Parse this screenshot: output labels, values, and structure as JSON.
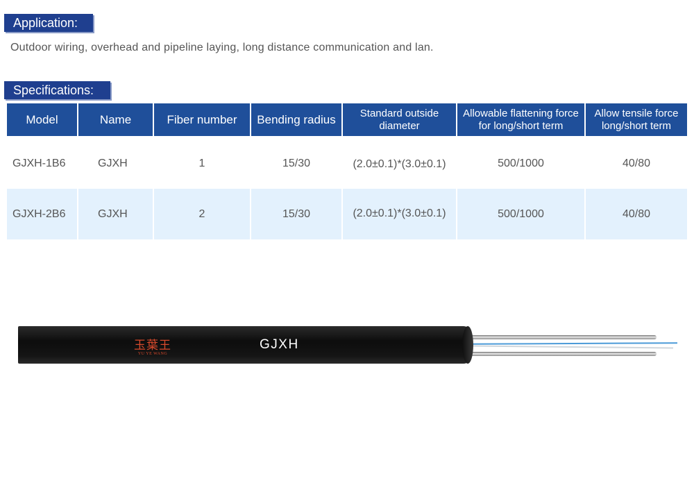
{
  "application": {
    "heading": "Application:",
    "text": "Outdoor wiring, overhead and pipeline laying, long distance communication and lan."
  },
  "specifications": {
    "heading": "Specifications:",
    "columns": [
      {
        "label_line1": "Model",
        "label_line2": ""
      },
      {
        "label_line1": "Name",
        "label_line2": ""
      },
      {
        "label_line1": "Fiber number",
        "label_line2": ""
      },
      {
        "label_line1": "Bending radius",
        "label_line2": ""
      },
      {
        "label_line1": "Standard outside",
        "label_line2": "diameter"
      },
      {
        "label_line1": "Allowable flattening force",
        "label_line2": "for long/short term"
      },
      {
        "label_line1": "Allow tensile force",
        "label_line2": "long/short term"
      }
    ],
    "rows": [
      [
        "GJXH-1B6",
        "GJXH",
        "1",
        "15/30",
        "(2.0±0.1)*(3.0±0.1)",
        "500/1000",
        "40/80"
      ],
      [
        "GJXH-2B6",
        "GJXH",
        "2",
        "15/30",
        "(2.0±0.1)*(3.0±0.1)",
        "500/1000",
        "40/80"
      ]
    ]
  },
  "cable_image": {
    "brand_name": "玉葉王",
    "brand_sub": "YU YE WANG",
    "label": "GJXH",
    "colors": {
      "jacket": "#111111",
      "brand": "#d84a2c",
      "fiber_blue": "#4a9ad8",
      "steel_wire": "#c8c8c8"
    }
  },
  "colors": {
    "header_bg": "#1f4f9a",
    "tag_bg": "#1f3f8f",
    "stripe_bg": "#e3f1fd",
    "text": "#555555"
  }
}
